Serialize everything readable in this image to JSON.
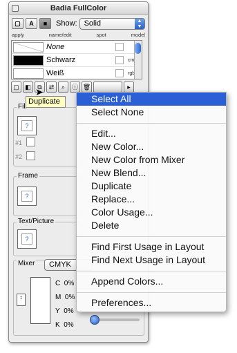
{
  "window": {
    "title": "Badia FullColor"
  },
  "show_row": {
    "show_label": "Show:",
    "show_value": "Solid",
    "btn_a": "A"
  },
  "column_headers": [
    "apply",
    "name/edit",
    "spot",
    "model"
  ],
  "colors": [
    {
      "name": "None",
      "italic": true,
      "model": "",
      "swatch": "#ffffff"
    },
    {
      "name": "Schwarz",
      "italic": false,
      "model": "cmyk",
      "swatch": "#000000"
    },
    {
      "name": "Weiß",
      "italic": false,
      "model": "rgb",
      "swatch": "#ffffff"
    }
  ],
  "tooltip": {
    "text": "Duplicate"
  },
  "fill": {
    "label": "Fill",
    "well": "?",
    "num1": "#1",
    "num2": "#2"
  },
  "frame": {
    "label": "Frame",
    "well": "?"
  },
  "text_picture": {
    "label": "Text/Picture",
    "well": "?"
  },
  "mixer": {
    "label": "Mixer",
    "model": "CMYK",
    "channels": [
      {
        "name": "C",
        "value": "0%"
      },
      {
        "name": "M",
        "value": "0%"
      },
      {
        "name": "Y",
        "value": "0%"
      },
      {
        "name": "K",
        "value": "0%"
      }
    ],
    "k_slider_level": 0
  },
  "menu": {
    "items": [
      {
        "label": "Select All",
        "highlighted": true
      },
      {
        "label": "Select None"
      },
      {
        "sep": true
      },
      {
        "label": "Edit..."
      },
      {
        "label": "New Color..."
      },
      {
        "label": "New Color from Mixer"
      },
      {
        "label": "New Blend..."
      },
      {
        "label": "Duplicate"
      },
      {
        "label": "Replace..."
      },
      {
        "label": "Color Usage..."
      },
      {
        "label": "Delete"
      },
      {
        "sep": true
      },
      {
        "label": "Find First Usage in Layout"
      },
      {
        "label": "Find Next Usage in Layout"
      },
      {
        "sep": true
      },
      {
        "label": "Append Colors..."
      },
      {
        "sep": true
      },
      {
        "label": "Preferences..."
      }
    ]
  },
  "colors_accent": {
    "highlight": "#2b5fd6",
    "tooltip_bg": "#ffffc4"
  }
}
